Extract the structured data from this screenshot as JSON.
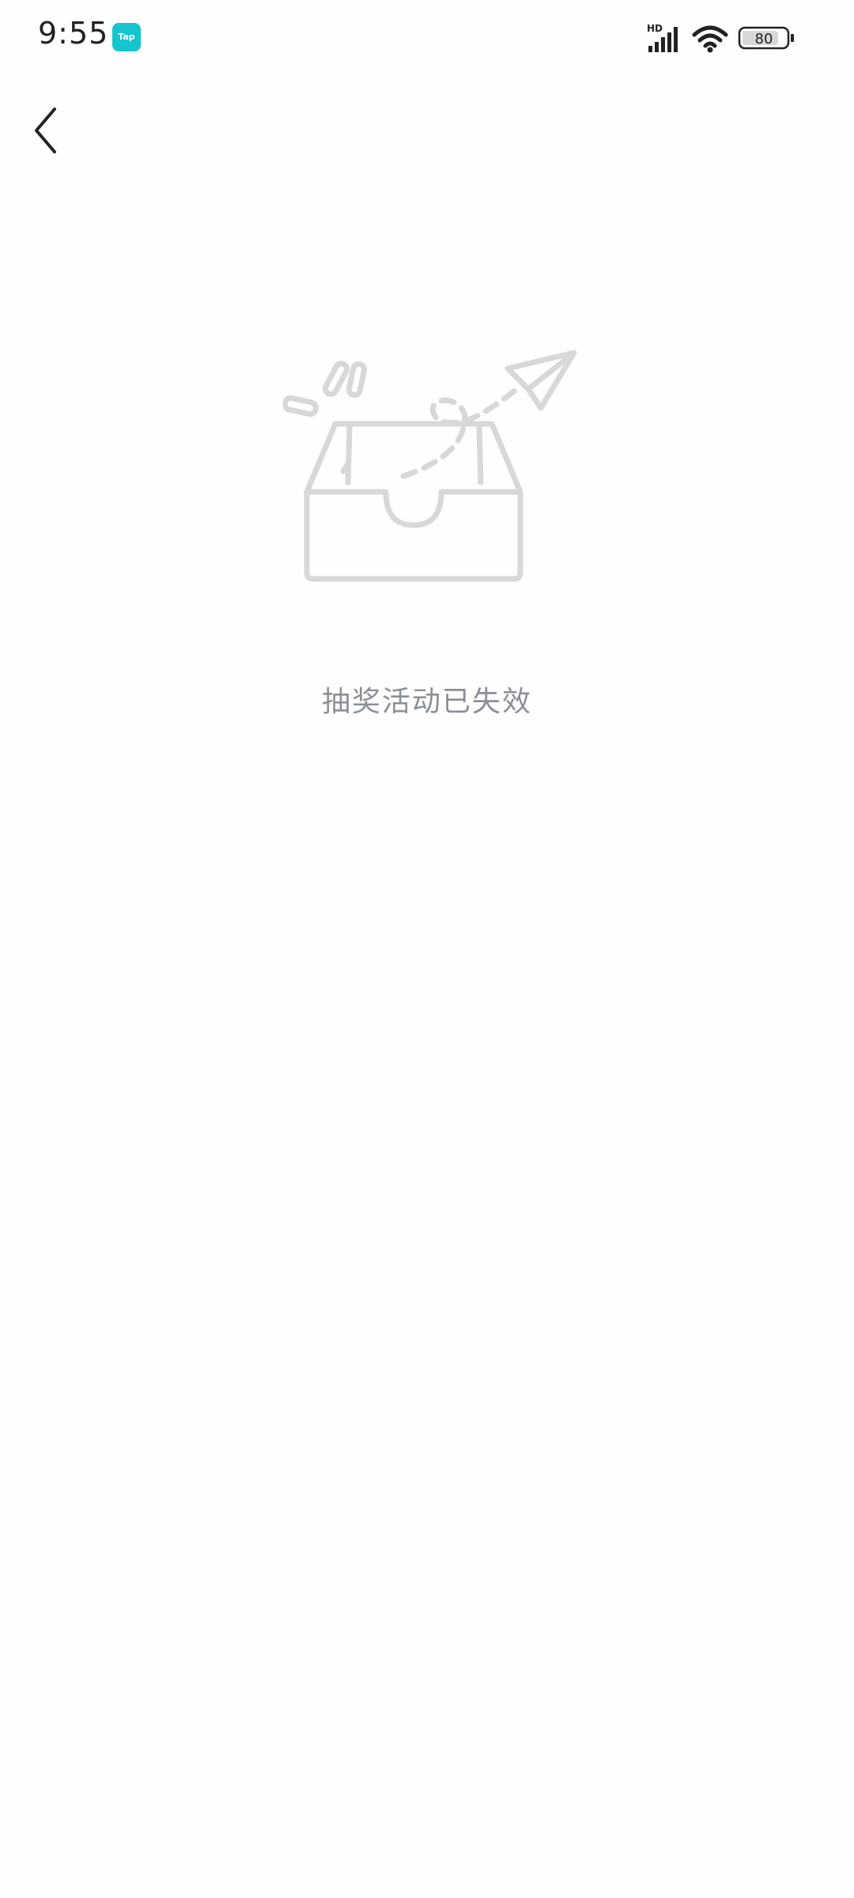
{
  "status_bar": {
    "time": "9:55",
    "app_badge": "Tap",
    "network_label": "HD",
    "battery_level": "80",
    "icons": [
      "signal-icon",
      "wifi-icon",
      "battery-icon"
    ]
  },
  "nav": {
    "back_icon": "chevron-left-icon"
  },
  "empty_state": {
    "illustration": "empty-inbox-paper-plane-illustration",
    "message": "抽奖活动已失效"
  },
  "colors": {
    "background": "#fefefe",
    "tap_badge": "#15c5ce",
    "illustration_stroke": "#d6d8d9",
    "message_text": "#8b9096",
    "icon_dark": "#222222"
  }
}
